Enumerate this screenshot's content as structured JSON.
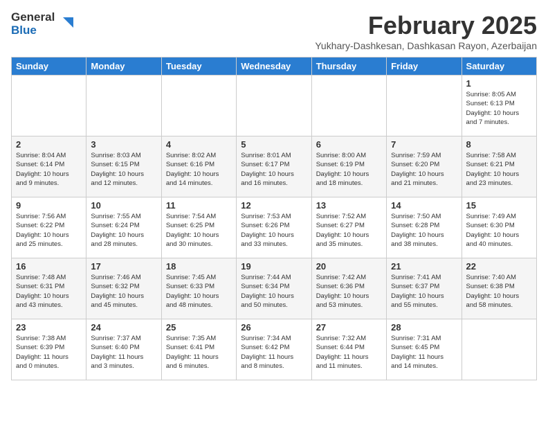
{
  "logo": {
    "general": "General",
    "blue": "Blue"
  },
  "title": {
    "month_year": "February 2025",
    "location": "Yukhary-Dashkesan, Dashkasan Rayon, Azerbaijan"
  },
  "headers": [
    "Sunday",
    "Monday",
    "Tuesday",
    "Wednesday",
    "Thursday",
    "Friday",
    "Saturday"
  ],
  "weeks": [
    [
      {
        "day": "",
        "info": ""
      },
      {
        "day": "",
        "info": ""
      },
      {
        "day": "",
        "info": ""
      },
      {
        "day": "",
        "info": ""
      },
      {
        "day": "",
        "info": ""
      },
      {
        "day": "",
        "info": ""
      },
      {
        "day": "1",
        "info": "Sunrise: 8:05 AM\nSunset: 6:13 PM\nDaylight: 10 hours\nand 7 minutes."
      }
    ],
    [
      {
        "day": "2",
        "info": "Sunrise: 8:04 AM\nSunset: 6:14 PM\nDaylight: 10 hours\nand 9 minutes."
      },
      {
        "day": "3",
        "info": "Sunrise: 8:03 AM\nSunset: 6:15 PM\nDaylight: 10 hours\nand 12 minutes."
      },
      {
        "day": "4",
        "info": "Sunrise: 8:02 AM\nSunset: 6:16 PM\nDaylight: 10 hours\nand 14 minutes."
      },
      {
        "day": "5",
        "info": "Sunrise: 8:01 AM\nSunset: 6:17 PM\nDaylight: 10 hours\nand 16 minutes."
      },
      {
        "day": "6",
        "info": "Sunrise: 8:00 AM\nSunset: 6:19 PM\nDaylight: 10 hours\nand 18 minutes."
      },
      {
        "day": "7",
        "info": "Sunrise: 7:59 AM\nSunset: 6:20 PM\nDaylight: 10 hours\nand 21 minutes."
      },
      {
        "day": "8",
        "info": "Sunrise: 7:58 AM\nSunset: 6:21 PM\nDaylight: 10 hours\nand 23 minutes."
      }
    ],
    [
      {
        "day": "9",
        "info": "Sunrise: 7:56 AM\nSunset: 6:22 PM\nDaylight: 10 hours\nand 25 minutes."
      },
      {
        "day": "10",
        "info": "Sunrise: 7:55 AM\nSunset: 6:24 PM\nDaylight: 10 hours\nand 28 minutes."
      },
      {
        "day": "11",
        "info": "Sunrise: 7:54 AM\nSunset: 6:25 PM\nDaylight: 10 hours\nand 30 minutes."
      },
      {
        "day": "12",
        "info": "Sunrise: 7:53 AM\nSunset: 6:26 PM\nDaylight: 10 hours\nand 33 minutes."
      },
      {
        "day": "13",
        "info": "Sunrise: 7:52 AM\nSunset: 6:27 PM\nDaylight: 10 hours\nand 35 minutes."
      },
      {
        "day": "14",
        "info": "Sunrise: 7:50 AM\nSunset: 6:28 PM\nDaylight: 10 hours\nand 38 minutes."
      },
      {
        "day": "15",
        "info": "Sunrise: 7:49 AM\nSunset: 6:30 PM\nDaylight: 10 hours\nand 40 minutes."
      }
    ],
    [
      {
        "day": "16",
        "info": "Sunrise: 7:48 AM\nSunset: 6:31 PM\nDaylight: 10 hours\nand 43 minutes."
      },
      {
        "day": "17",
        "info": "Sunrise: 7:46 AM\nSunset: 6:32 PM\nDaylight: 10 hours\nand 45 minutes."
      },
      {
        "day": "18",
        "info": "Sunrise: 7:45 AM\nSunset: 6:33 PM\nDaylight: 10 hours\nand 48 minutes."
      },
      {
        "day": "19",
        "info": "Sunrise: 7:44 AM\nSunset: 6:34 PM\nDaylight: 10 hours\nand 50 minutes."
      },
      {
        "day": "20",
        "info": "Sunrise: 7:42 AM\nSunset: 6:36 PM\nDaylight: 10 hours\nand 53 minutes."
      },
      {
        "day": "21",
        "info": "Sunrise: 7:41 AM\nSunset: 6:37 PM\nDaylight: 10 hours\nand 55 minutes."
      },
      {
        "day": "22",
        "info": "Sunrise: 7:40 AM\nSunset: 6:38 PM\nDaylight: 10 hours\nand 58 minutes."
      }
    ],
    [
      {
        "day": "23",
        "info": "Sunrise: 7:38 AM\nSunset: 6:39 PM\nDaylight: 11 hours\nand 0 minutes."
      },
      {
        "day": "24",
        "info": "Sunrise: 7:37 AM\nSunset: 6:40 PM\nDaylight: 11 hours\nand 3 minutes."
      },
      {
        "day": "25",
        "info": "Sunrise: 7:35 AM\nSunset: 6:41 PM\nDaylight: 11 hours\nand 6 minutes."
      },
      {
        "day": "26",
        "info": "Sunrise: 7:34 AM\nSunset: 6:42 PM\nDaylight: 11 hours\nand 8 minutes."
      },
      {
        "day": "27",
        "info": "Sunrise: 7:32 AM\nSunset: 6:44 PM\nDaylight: 11 hours\nand 11 minutes."
      },
      {
        "day": "28",
        "info": "Sunrise: 7:31 AM\nSunset: 6:45 PM\nDaylight: 11 hours\nand 14 minutes."
      },
      {
        "day": "",
        "info": ""
      }
    ]
  ]
}
